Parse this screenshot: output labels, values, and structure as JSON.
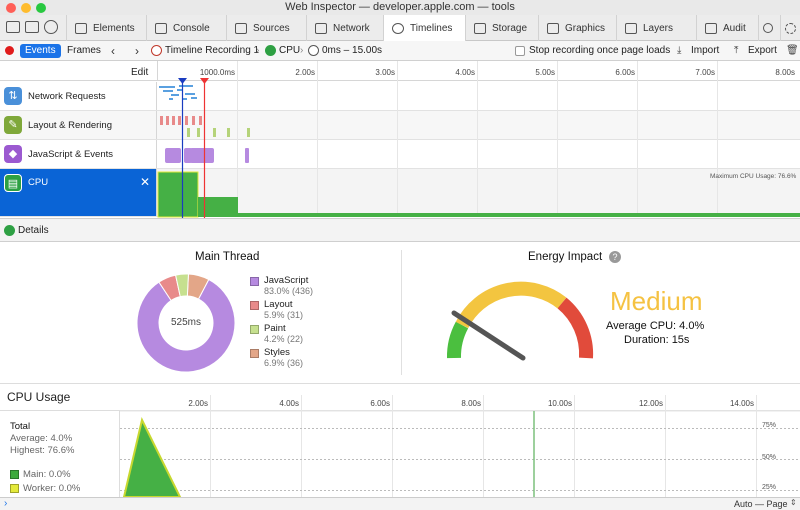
{
  "window": {
    "title": "Web Inspector — developer.apple.com — tools"
  },
  "tabs": [
    {
      "label": "Elements"
    },
    {
      "label": "Console"
    },
    {
      "label": "Sources"
    },
    {
      "label": "Network"
    },
    {
      "label": "Timelines"
    },
    {
      "label": "Storage"
    },
    {
      "label": "Graphics"
    },
    {
      "label": "Layers"
    },
    {
      "label": "Audit"
    }
  ],
  "toolbar": {
    "events_label": "Events",
    "frames_label": "Frames",
    "recording_label": "Timeline Recording 1",
    "cpu_label": "CPU",
    "range_label": "0ms – 15.00s",
    "stop_recording_label": "Stop recording once page loads",
    "import_label": "Import",
    "export_label": "Export"
  },
  "ruler": {
    "edit_label": "Edit",
    "ticks": [
      "1000.0ms",
      "2.00s",
      "3.00s",
      "4.00s",
      "5.00s",
      "6.00s",
      "7.00s",
      "8.00s"
    ]
  },
  "timeline_rows": [
    {
      "label": "Network Requests",
      "color": "#4a90d9"
    },
    {
      "label": "Layout & Rendering",
      "color": "#7fa83a"
    },
    {
      "label": "JavaScript & Events",
      "color": "#9b59d0"
    },
    {
      "label": "CPU",
      "color": "#2ea043"
    }
  ],
  "cpu_track": {
    "max_label": "Maximum CPU Usage: 76.6%"
  },
  "details": {
    "label": "Details"
  },
  "main_thread": {
    "title": "Main Thread",
    "center_label": "525ms",
    "legend": [
      {
        "name": "JavaScript",
        "value": "83.0% (436)",
        "color": "#b68ae0",
        "fraction": 0.83
      },
      {
        "name": "Layout",
        "value": "5.9% (31)",
        "color": "#e88a8a",
        "fraction": 0.059
      },
      {
        "name": "Paint",
        "value": "4.2% (22)",
        "color": "#c6e08f",
        "fraction": 0.042
      },
      {
        "name": "Styles",
        "value": "6.9% (36)",
        "color": "#e3a688",
        "fraction": 0.069
      }
    ]
  },
  "energy": {
    "title": "Energy Impact",
    "help": "?",
    "level": "Medium",
    "average_cpu": "Average CPU: 4.0%",
    "duration": "Duration: 15s"
  },
  "cpu_usage": {
    "title": "CPU Usage",
    "ticks": [
      "2.00s",
      "4.00s",
      "6.00s",
      "8.00s",
      "10.00s",
      "12.00s",
      "14.00s"
    ],
    "axis_labels": [
      "75%",
      "50%",
      "25%"
    ],
    "total_label": "Total",
    "average": "Average: 4.0%",
    "highest": "Highest: 76.6%",
    "main": {
      "label": "Main: 0.0%",
      "color": "#3daa3d"
    },
    "worker": {
      "label": "Worker: 0.0%",
      "color": "#e4ea3b"
    }
  },
  "bottom": {
    "mode_label": "Auto — Page"
  }
}
